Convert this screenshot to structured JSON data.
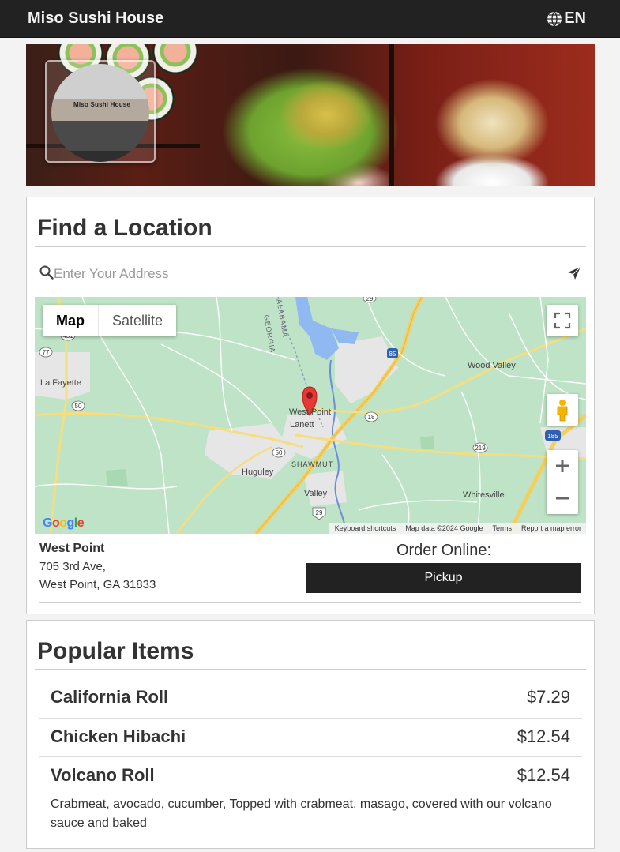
{
  "header": {
    "brand": "Miso Sushi House",
    "language": "EN",
    "language_icon": "globe-icon"
  },
  "hero": {
    "store_sign": "Miso Sushi House"
  },
  "find_location": {
    "title": "Find a Location",
    "search_placeholder": "Enter Your Address",
    "map": {
      "type_buttons": [
        "Map",
        "Satellite"
      ],
      "active_type": "Map",
      "labels": {
        "la_fayette": "La Fayette",
        "west_point": "West Point",
        "lanett": "Lanett",
        "shawmut": "SHAWMUT",
        "huguley": "Huguley",
        "valley": "Valley",
        "wood_valley": "Wood Valley",
        "whitesville": "Whitesville",
        "georgia": "GEORGIA",
        "alabama": "ALABAMA"
      },
      "route_shields": [
        "77",
        "431",
        "50",
        "50",
        "18",
        "85",
        "219",
        "185",
        "29",
        "29"
      ],
      "attribution": [
        "Keyboard shortcuts",
        "Map data ©2024 Google",
        "Terms",
        "Report a map error"
      ],
      "google_logo": "Google"
    },
    "location": {
      "name": "West Point",
      "address_line1": "705 3rd Ave,",
      "address_line2": "West Point, GA 31833"
    },
    "order": {
      "title": "Order Online:",
      "pickup_label": "Pickup"
    }
  },
  "popular": {
    "title": "Popular Items",
    "items": [
      {
        "name": "California Roll",
        "price": "$7.29",
        "description": ""
      },
      {
        "name": "Chicken Hibachi",
        "price": "$12.54",
        "description": ""
      },
      {
        "name": "Volcano Roll",
        "price": "$12.54",
        "description": "Crabmeat, avocado, cucumber, Topped with crabmeat, masago, covered with our volcano sauce and baked"
      }
    ]
  },
  "colors": {
    "topbar": "#222222",
    "button": "#222222",
    "map_green": "#bfe3c6",
    "marker": "#e53935"
  }
}
